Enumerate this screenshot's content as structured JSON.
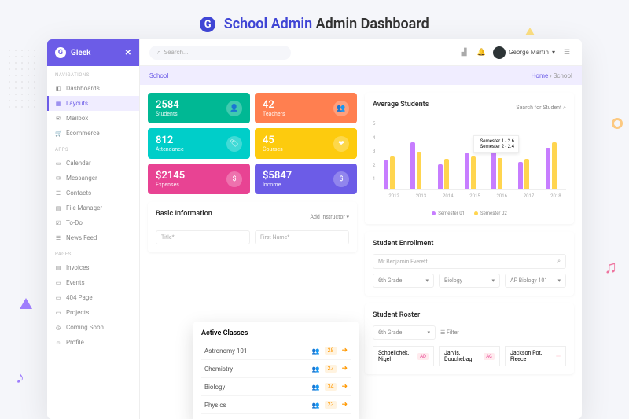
{
  "page_title": {
    "bold": "School Admin",
    "rest": "Admin Dashboard"
  },
  "brand": "Gleek",
  "topbar": {
    "search_placeholder": "Search...",
    "user": "George Martin"
  },
  "crumbs": {
    "title": "School",
    "home": "Home",
    "current": "School"
  },
  "sidebar": {
    "sections": [
      {
        "label": "NAVIGATIONS",
        "items": [
          {
            "icon": "◧",
            "label": "Dashboards"
          },
          {
            "icon": "▦",
            "label": "Layouts",
            "active": true
          },
          {
            "icon": "✉",
            "label": "Mailbox"
          },
          {
            "icon": "🛒",
            "label": "Ecommerce"
          }
        ]
      },
      {
        "label": "APPS",
        "items": [
          {
            "icon": "▭",
            "label": "Calendar"
          },
          {
            "icon": "✉",
            "label": "Messanger"
          },
          {
            "icon": "☰",
            "label": "Contacts"
          },
          {
            "icon": "▤",
            "label": "File Manager"
          },
          {
            "icon": "☑",
            "label": "To-Do"
          },
          {
            "icon": "☰",
            "label": "News Feed"
          }
        ]
      },
      {
        "label": "PAGES",
        "items": [
          {
            "icon": "▤",
            "label": "Invoices"
          },
          {
            "icon": "▭",
            "label": "Events"
          },
          {
            "icon": "▭",
            "label": "404 Page"
          },
          {
            "icon": "▭",
            "label": "Projects"
          },
          {
            "icon": "◷",
            "label": "Coming Soon"
          },
          {
            "icon": "☺",
            "label": "Profile"
          }
        ]
      }
    ]
  },
  "stats": [
    {
      "value": "2584",
      "label": "Students",
      "color": "c-green",
      "icon": "👤"
    },
    {
      "value": "42",
      "label": "Teachers",
      "color": "c-orange",
      "icon": "👥"
    },
    {
      "value": "812",
      "label": "Attendance",
      "color": "c-teal",
      "icon": "🏷"
    },
    {
      "value": "45",
      "label": "Courses",
      "color": "c-yellow",
      "icon": "❤"
    },
    {
      "value": "$2145",
      "label": "Expenses",
      "color": "c-pink",
      "icon": "$"
    },
    {
      "value": "$5847",
      "label": "Income",
      "color": "c-purple",
      "icon": "$"
    }
  ],
  "basic_info": {
    "title": "Basic Information",
    "add": "Add Instructor ▾",
    "fields": {
      "title": "Title*",
      "first": "First Name*"
    }
  },
  "active_classes": {
    "title": "Active Classes",
    "items": [
      {
        "name": "Astronomy 101",
        "count": "28"
      },
      {
        "name": "Chemistry",
        "count": "27"
      },
      {
        "name": "Biology",
        "count": "34"
      },
      {
        "name": "Physics",
        "count": "23"
      }
    ]
  },
  "chart_card": {
    "title": "Average Students",
    "search": "Search for Student",
    "legend": [
      "Semester 01",
      "Semester 02"
    ],
    "tooltip": [
      "Semester 1 - 2.6",
      "Semester 2 - 2.4"
    ]
  },
  "chart_data": {
    "type": "bar",
    "title": "Average Students",
    "xlabel": "",
    "ylabel": "",
    "ylim": [
      0,
      5
    ],
    "categories": [
      "2012",
      "2013",
      "2014",
      "2015",
      "2016",
      "2017",
      "2018"
    ],
    "series": [
      {
        "name": "Semester 01",
        "color": "#c77dff",
        "values": [
          2.1,
          3.4,
          1.8,
          2.6,
          3.8,
          2.0,
          3.0
        ]
      },
      {
        "name": "Semester 02",
        "color": "#ffd54f",
        "values": [
          2.4,
          2.7,
          2.2,
          2.4,
          2.3,
          2.2,
          3.4
        ]
      }
    ]
  },
  "enrollment": {
    "title": "Student Enrollment",
    "placeholder": "Mr Benjamin Everett",
    "selects": [
      "6th Grade",
      "Biology",
      "AP Biology 101"
    ]
  },
  "roster": {
    "title": "Student Roster",
    "grade": "6th Grade",
    "filter": "Filter",
    "items": [
      {
        "name": "Schpellchek, Nigel",
        "badge": "AD"
      },
      {
        "name": "Jarvis, Douchebag",
        "badge": "AC"
      },
      {
        "name": "Jackson Pot, Fleece",
        "badge": ""
      }
    ]
  }
}
